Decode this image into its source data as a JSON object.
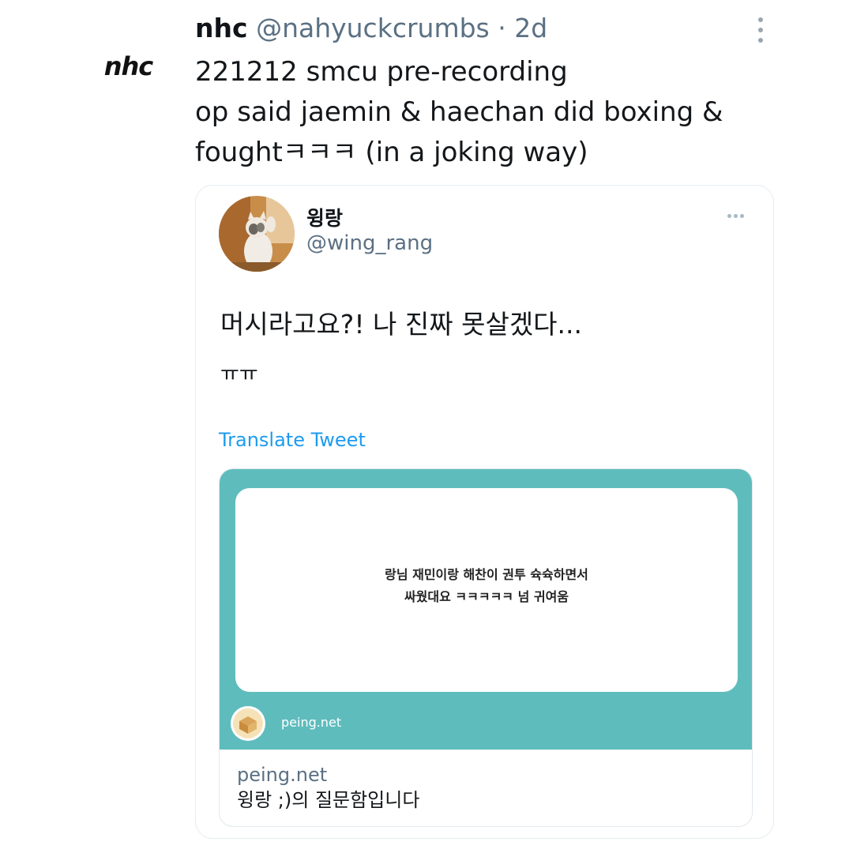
{
  "tweet": {
    "avatar_text": "nhc",
    "display_name": "nhc",
    "handle": "@nahyuckcrumbs",
    "separator": "·",
    "time": "2d",
    "text_lines": [
      "221212 smcu pre-recording",
      "op said jaemin & haechan did boxing &",
      "foughtㅋㅋㅋ (in a joking way)"
    ]
  },
  "quote": {
    "display_name": "윙랑",
    "handle": "@wing_rang",
    "text_line1": "머시라고요?! 나 진짜 못살겠다...",
    "text_line2": "ㅠㅠ",
    "translate_label": "Translate Tweet",
    "card": {
      "image_question_lines": [
        "랑님 재민이랑 해찬이 권투 슉슉하면서",
        "싸웠대요 ㅋㅋㅋㅋㅋ 넘 귀여움"
      ],
      "image_footer": "peing.net",
      "domain": "peing.net",
      "title": "윙랑 ;)의 질문함입니다"
    }
  },
  "colors": {
    "accent": "#1d9bf0",
    "peing_teal": "#5fbcbd",
    "secondary_text": "#5b7083"
  },
  "icons": [
    "more-vertical-icon",
    "more-horizontal-icon",
    "peing-box-icon"
  ]
}
